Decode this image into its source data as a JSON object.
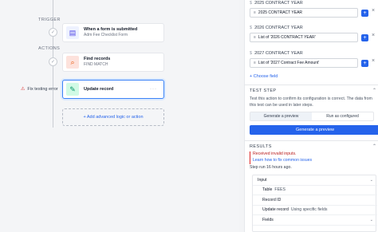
{
  "canvas": {
    "trigger_label": "TRIGGER",
    "actions_label": "ACTIONS",
    "trigger_card": {
      "title": "When a form is submitted",
      "subtitle": "Adm Fee Checklist Form"
    },
    "find_card": {
      "title": "Find records",
      "subtitle": "FIND MATCH"
    },
    "update_card": {
      "title": "Update record",
      "menu": "···"
    },
    "error_text": "Fix testing error",
    "advanced_link": "+ Add advanced logic or action"
  },
  "panel": {
    "fields": [
      {
        "label": "2025 CONTRACT YEAR",
        "prefix": "≡",
        "value": "2025 CONTRACT YEAR"
      },
      {
        "label": "2026 CONTRACT YEAR",
        "prefix": "≡",
        "value": "List of '2026 CONTRACT YEAR'"
      },
      {
        "label": "2027 CONTRACT YEAR",
        "prefix": "≡",
        "value": "List of '2027 Contract Fee Amount'"
      }
    ],
    "add_label": "+",
    "remove_label": "×",
    "choose_field": "+ Choose field",
    "test_step": {
      "title": "TEST STEP",
      "description": "Test this action to confirm its configuration is correct. The data from this test can be used in later steps.",
      "tabs": [
        "Generate a preview",
        "Run as configured"
      ],
      "button": "Generate a preview"
    },
    "results": {
      "title": "RESULTS",
      "error_line1": "Received invalid inputs.",
      "error_line2": "Learn how to fix common issues",
      "step_note": "Step run 16 hours ago.",
      "rows": [
        {
          "key": "Input",
          "value": ""
        },
        {
          "key": "Table",
          "value": "FEES"
        },
        {
          "key": "Record ID",
          "value": ""
        },
        {
          "key": "Update record",
          "value": "Using specific fields"
        },
        {
          "key": "Fields",
          "value": ""
        }
      ]
    }
  }
}
